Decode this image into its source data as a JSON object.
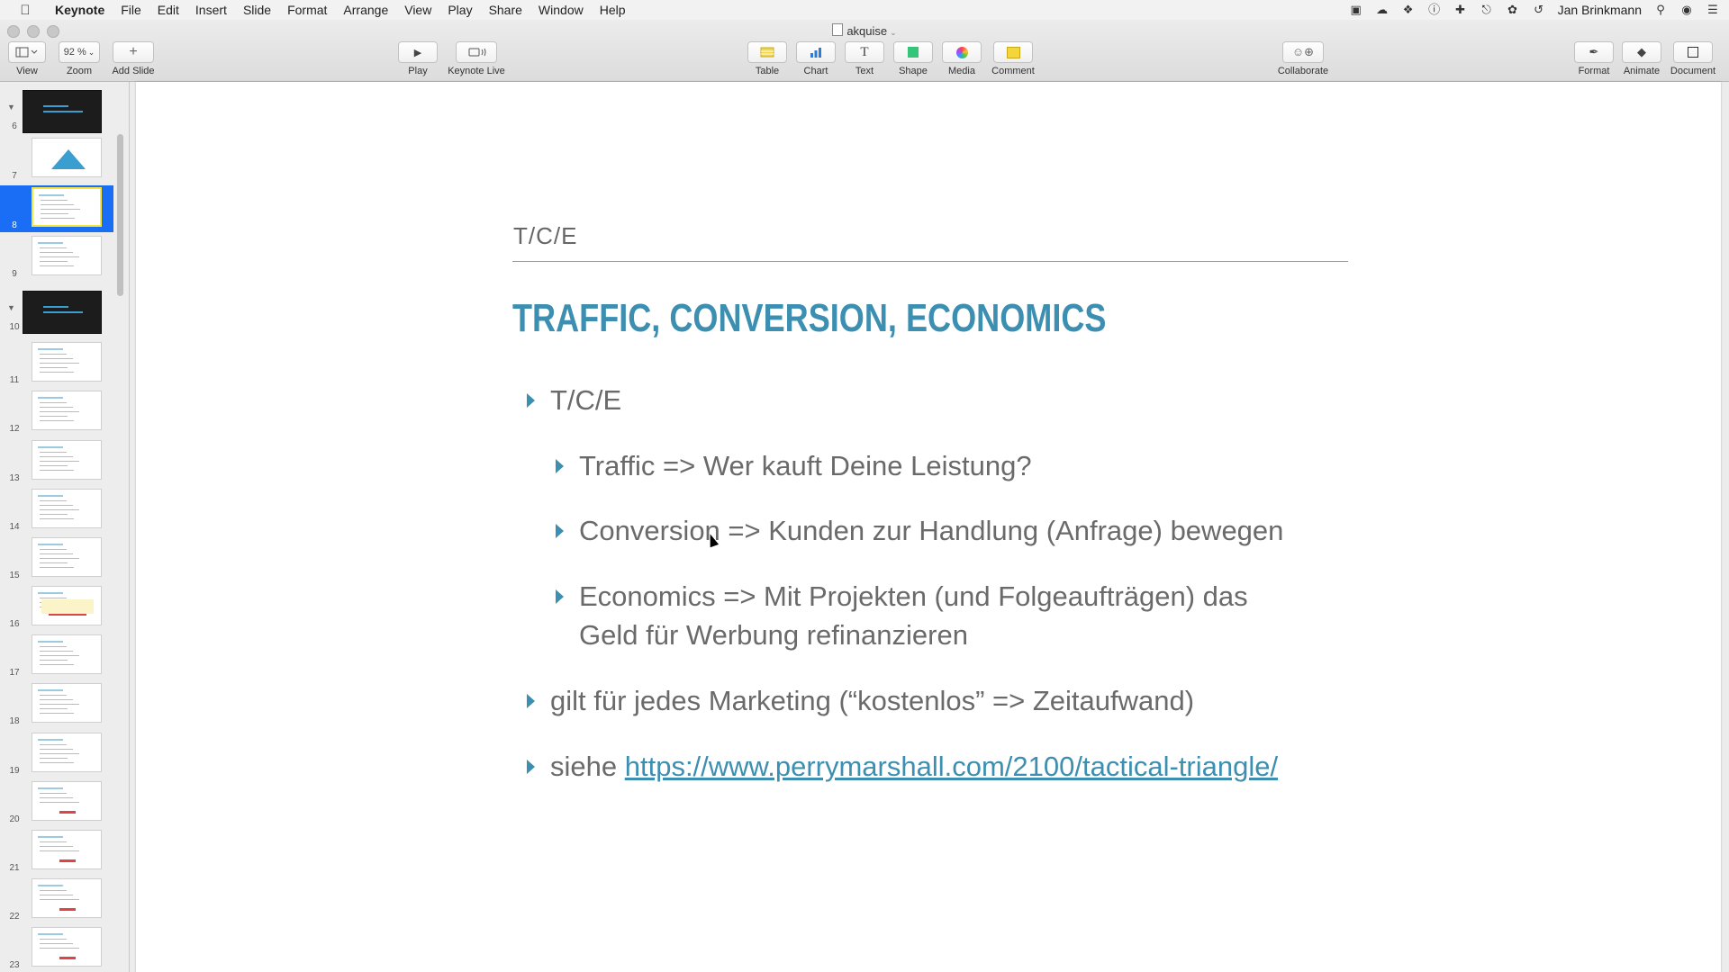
{
  "menubar": {
    "app": "Keynote",
    "items": [
      "File",
      "Edit",
      "Insert",
      "Slide",
      "Format",
      "Arrange",
      "View",
      "Play",
      "Share",
      "Window",
      "Help"
    ],
    "user": "Jan Brinkmann"
  },
  "window": {
    "title": "akquise"
  },
  "toolbar": {
    "view_label": "View",
    "zoom_value": "92 %",
    "zoom_label": "Zoom",
    "add_slide_label": "Add Slide",
    "play_label": "Play",
    "keynote_live_label": "Keynote Live",
    "table_label": "Table",
    "chart_label": "Chart",
    "text_label": "Text",
    "shape_label": "Shape",
    "media_label": "Media",
    "comment_label": "Comment",
    "collaborate_label": "Collaborate",
    "format_label": "Format",
    "animate_label": "Animate",
    "document_label": "Document",
    "colors": {
      "table": "#f1d64a",
      "chart": "#2f7ad6",
      "shape": "#36c47a",
      "comment": "#f4d63a"
    }
  },
  "navigator": {
    "slides": [
      {
        "num": "6",
        "kind": "dark",
        "group": true
      },
      {
        "num": "7",
        "kind": "triangle"
      },
      {
        "num": "8",
        "kind": "text",
        "selected": true
      },
      {
        "num": "9",
        "kind": "text"
      },
      {
        "num": "10",
        "kind": "dark",
        "group": true
      },
      {
        "num": "11",
        "kind": "text"
      },
      {
        "num": "12",
        "kind": "text"
      },
      {
        "num": "13",
        "kind": "text"
      },
      {
        "num": "14",
        "kind": "text"
      },
      {
        "num": "15",
        "kind": "text"
      },
      {
        "num": "16",
        "kind": "yellow"
      },
      {
        "num": "17",
        "kind": "text"
      },
      {
        "num": "18",
        "kind": "text"
      },
      {
        "num": "19",
        "kind": "text"
      },
      {
        "num": "20",
        "kind": "red"
      },
      {
        "num": "21",
        "kind": "red"
      },
      {
        "num": "22",
        "kind": "red"
      },
      {
        "num": "23",
        "kind": "red"
      }
    ]
  },
  "slide": {
    "subtitle": "T/C/E",
    "title": "TRAFFIC, CONVERSION, ECONOMICS",
    "accent_color": "#3c8fb0",
    "bullets": {
      "b1": "T/C/E",
      "b1a": "Traffic => Wer kauft Deine Leistung?",
      "b1b": "Conversion => Kunden zur Handlung (Anfrage) bewegen",
      "b1c_line1": "Economics => Mit Projekten (und Folgeaufträgen) das",
      "b1c_line2": "Geld für Werbung refinanzieren",
      "b2": "gilt für jedes Marketing (“kostenlos” => Zeitaufwand)",
      "b3_prefix": "siehe ",
      "b3_link": "https://www.perrymarshall.com/2100/tactical-triangle/"
    }
  }
}
